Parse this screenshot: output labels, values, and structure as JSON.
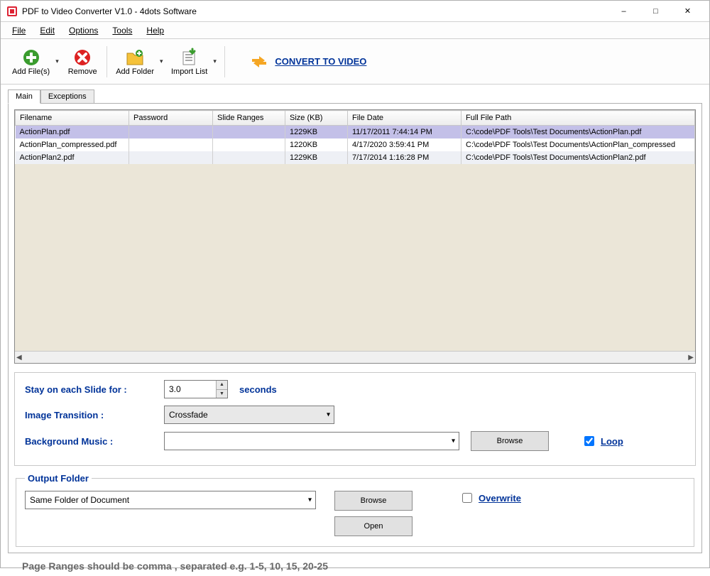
{
  "window": {
    "title": "PDF to Video Converter V1.0 - 4dots Software"
  },
  "menu": {
    "file": "File",
    "edit": "Edit",
    "options": "Options",
    "tools": "Tools",
    "help": "Help"
  },
  "toolbar": {
    "add_files": "Add File(s)",
    "remove": "Remove",
    "add_folder": "Add Folder",
    "import_list": "Import List",
    "convert": "CONVERT TO VIDEO"
  },
  "tabs": {
    "main": "Main",
    "exceptions": "Exceptions"
  },
  "columns": {
    "filename": "Filename",
    "password": "Password",
    "slide_ranges": "Slide Ranges",
    "size": "Size (KB)",
    "file_date": "File Date",
    "full_path": "Full File Path"
  },
  "rows": [
    {
      "filename": "ActionPlan.pdf",
      "password": "",
      "slide_ranges": "",
      "size": "1229KB",
      "file_date": "11/17/2011 7:44:14 PM",
      "full_path": "C:\\code\\PDF Tools\\Test Documents\\ActionPlan.pdf",
      "selected": true
    },
    {
      "filename": "ActionPlan_compressed.pdf",
      "password": "",
      "slide_ranges": "",
      "size": "1220KB",
      "file_date": "4/17/2020 3:59:41 PM",
      "full_path": "C:\\code\\PDF Tools\\Test Documents\\ActionPlan_compressed",
      "selected": false
    },
    {
      "filename": "ActionPlan2.pdf",
      "password": "",
      "slide_ranges": "",
      "size": "1229KB",
      "file_date": "7/17/2014 1:16:28 PM",
      "full_path": "C:\\code\\PDF Tools\\Test Documents\\ActionPlan2.pdf",
      "selected": false
    }
  ],
  "settings": {
    "stay_label": "Stay on each Slide for :",
    "stay_value": "3.0",
    "stay_unit": "seconds",
    "transition_label": "Image Transition :",
    "transition_value": "Crossfade",
    "music_label": "Background Music :",
    "music_value": "",
    "browse": "Browse",
    "loop": "Loop"
  },
  "output": {
    "legend": "Output Folder",
    "folder_value": "Same Folder of Document",
    "browse": "Browse",
    "open": "Open",
    "overwrite": "Overwrite"
  },
  "footer": {
    "hint": "Page Ranges should be comma , separated e.g. 1-5, 10, 15, 20-25"
  }
}
